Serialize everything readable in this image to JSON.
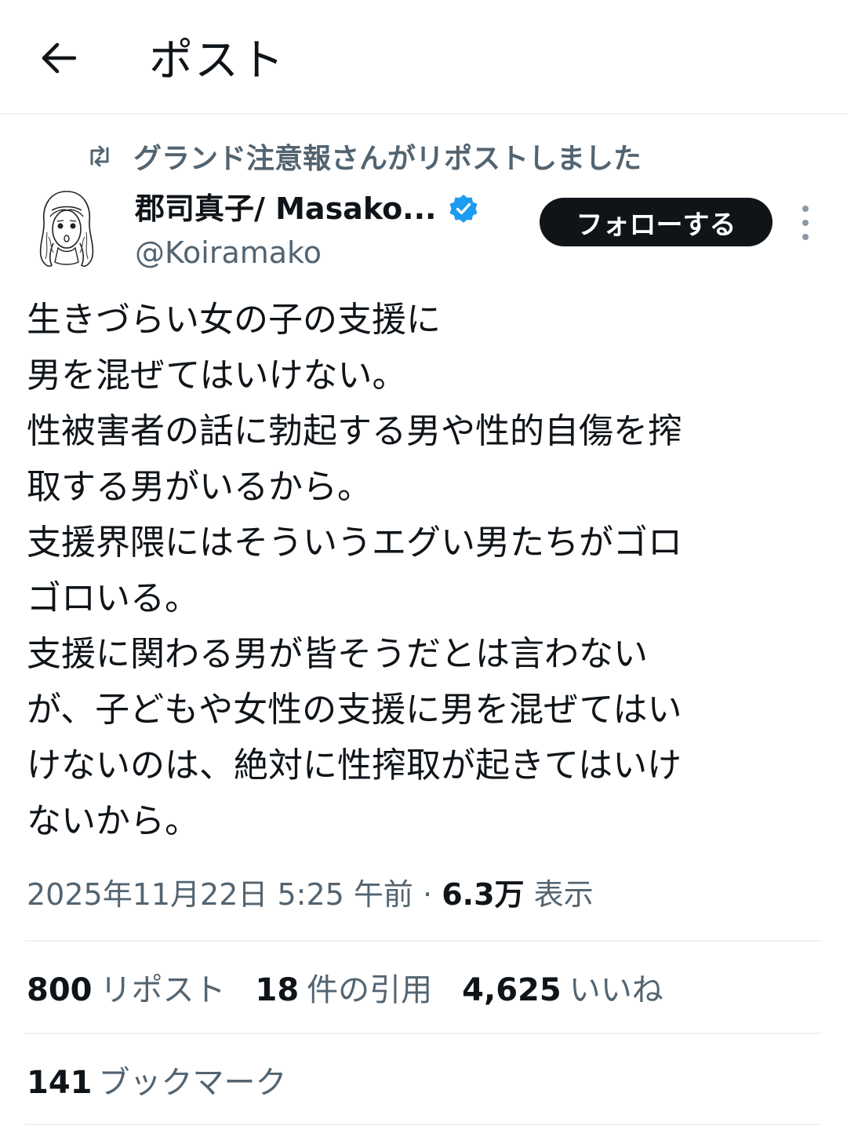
{
  "header": {
    "title": "ポスト"
  },
  "repost": {
    "text": "グランド注意報さんがリポストしました"
  },
  "author": {
    "display_name": "郡司真子/ Masako...",
    "handle": "@Koiramako",
    "verified": true
  },
  "follow_button": {
    "label": "フォローする"
  },
  "tweet": {
    "lines": [
      "生きづらい女の子の支援に",
      "男を混ぜてはいけない。",
      "性被害者の話に勃起する男や性的自傷を搾",
      "取する男がいるから。",
      "支援界隈にはそういうエグい男たちがゴロ",
      "ゴロいる。",
      "支援に関わる男が皆そうだとは言わない",
      "が、子どもや女性の支援に男を混ぜてはい",
      "けないのは、絶対に性搾取が起きてはいけ",
      "ないから。"
    ]
  },
  "meta": {
    "timestamp": "2025年11月22日 5:25 午前",
    "separator": "·",
    "views_count": "6.3万",
    "views_label": "表示"
  },
  "stats": {
    "reposts_count": "800",
    "reposts_label": "リポスト",
    "quotes_count": "18",
    "quotes_label": "件の引用",
    "likes_count": "4,625",
    "likes_label": "いいね",
    "bookmarks_count": "141",
    "bookmarks_label": "ブックマーク"
  },
  "colors": {
    "text": "#0f1419",
    "secondary": "#536471",
    "verified": "#1d9bf0",
    "divider": "#eff3f4",
    "button_bg": "#0f1419"
  },
  "icons": {
    "back": "arrow-left-icon",
    "repost": "repost-icon",
    "verified": "verified-badge-icon",
    "more": "more-vertical-icon"
  }
}
